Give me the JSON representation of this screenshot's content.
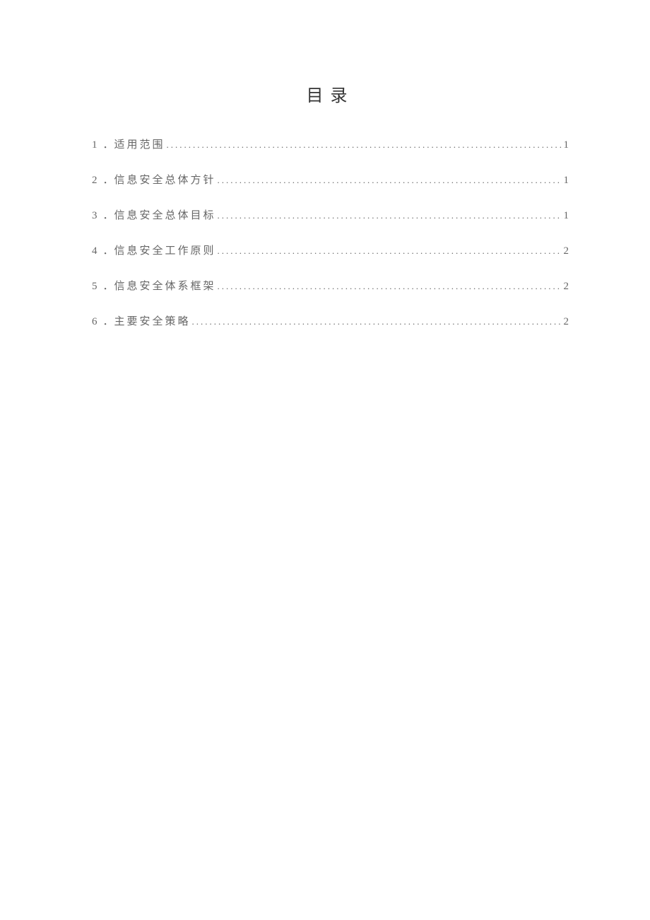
{
  "title": "目录",
  "toc": [
    {
      "num": "1",
      "sep": "．",
      "label": "适用范围",
      "page": "1"
    },
    {
      "num": "2",
      "sep": "．",
      "label": "信息安全总体方针",
      "page": "1"
    },
    {
      "num": "3",
      "sep": "．",
      "label": "信息安全总体目标",
      "page": "1"
    },
    {
      "num": "4",
      "sep": "．",
      "label": "信息安全工作原则",
      "page": "2"
    },
    {
      "num": "5",
      "sep": "．",
      "label": "信息安全体系框架",
      "page": "2"
    },
    {
      "num": "6",
      "sep": "．",
      "label": "主要安全策略",
      "page": "2"
    }
  ]
}
